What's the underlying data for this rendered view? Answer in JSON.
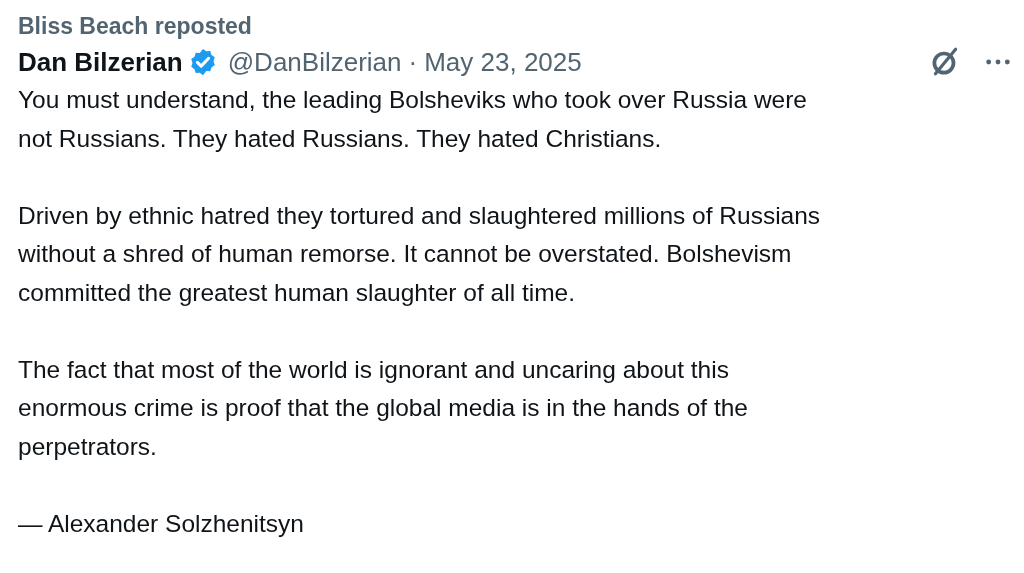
{
  "social_context": "Bliss Beach reposted",
  "post": {
    "author_name": "Dan Bilzerian",
    "verified": true,
    "handle": "@DanBilzerian",
    "separator": "·",
    "date": "May 23, 2025",
    "paragraphs": [
      "You must understand, the leading Bolsheviks who took over Russia were\nnot Russians. They hated Russians. They hated Christians.",
      "Driven by ethnic hatred they tortured and slaughtered millions of Russians\nwithout a shred of human remorse. It cannot be overstated. Bolshevism\ncommitted the greatest human slaughter of all time.",
      "The fact that most of the world is ignorant and uncaring about this\nenormous crime is proof that the global media is in the hands of the\nperpetrators.",
      "— Alexander Solzhenitsyn"
    ]
  }
}
